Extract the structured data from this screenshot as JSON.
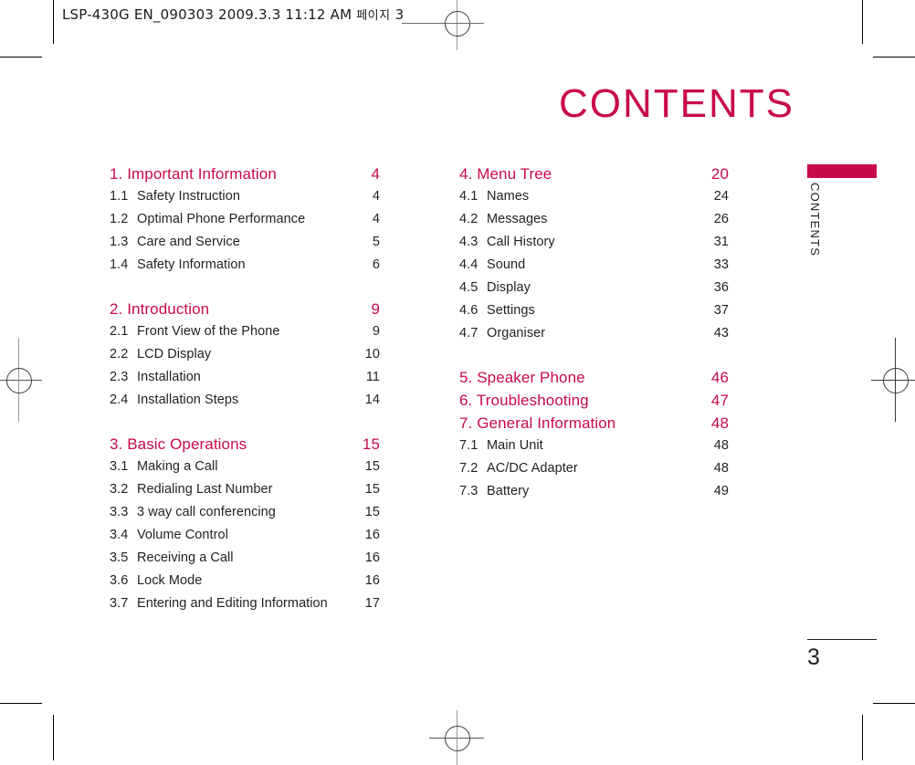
{
  "header": {
    "slug_main": "LSP-430G EN_090303  2009.3.3 11:12 AM",
    "slug_korean": "페이지",
    "slug_page": "3"
  },
  "page_title": "CONTENTS",
  "side_tab": {
    "label": "CONTENTS",
    "color": "#c80a4b"
  },
  "folio": {
    "number": "3"
  },
  "toc": {
    "left_column": [
      {
        "type": "chapter",
        "label": "1. Important Information",
        "page": "4",
        "children": [
          {
            "num": "1.1",
            "label": "Safety Instruction",
            "page": "4"
          },
          {
            "num": "1.2",
            "label": "Optimal Phone Performance",
            "page": "4"
          },
          {
            "num": "1.3",
            "label": "Care and Service",
            "page": "5"
          },
          {
            "num": "1.4",
            "label": "Safety Information",
            "page": "6"
          }
        ]
      },
      {
        "type": "chapter",
        "label": "2. Introduction",
        "page": "9",
        "children": [
          {
            "num": "2.1",
            "label": "Front View of the Phone",
            "page": "9"
          },
          {
            "num": "2.2",
            "label": "LCD Display",
            "page": "10"
          },
          {
            "num": "2.3",
            "label": "Installation",
            "page": "11"
          },
          {
            "num": "2.4",
            "label": "Installation Steps",
            "page": "14"
          }
        ]
      },
      {
        "type": "chapter",
        "label": "3. Basic Operations",
        "page": "15",
        "children": [
          {
            "num": "3.1",
            "label": "Making a Call",
            "page": "15"
          },
          {
            "num": "3.2",
            "label": "Redialing Last Number",
            "page": "15"
          },
          {
            "num": "3.3",
            "label": "3 way call conferencing",
            "page": "15"
          },
          {
            "num": "3.4",
            "label": "Volume Control",
            "page": "16"
          },
          {
            "num": "3.5",
            "label": "Receiving a Call",
            "page": "16"
          },
          {
            "num": "3.6",
            "label": "Lock Mode",
            "page": "16"
          },
          {
            "num": "3.7",
            "label": "Entering and Editing Information",
            "page": "17"
          }
        ]
      }
    ],
    "right_column": [
      {
        "type": "chapter",
        "label": "4. Menu Tree",
        "page": "20",
        "children": [
          {
            "num": "4.1",
            "label": "Names",
            "page": "24"
          },
          {
            "num": "4.2",
            "label": "Messages",
            "page": "26"
          },
          {
            "num": "4.3",
            "label": "Call History",
            "page": "31"
          },
          {
            "num": "4.4",
            "label": "Sound",
            "page": "33"
          },
          {
            "num": "4.5",
            "label": "Display",
            "page": "36"
          },
          {
            "num": "4.6",
            "label": "Settings",
            "page": "37"
          },
          {
            "num": "4.7",
            "label": "Organiser",
            "page": "43"
          }
        ]
      },
      {
        "type": "chapter",
        "label": "5. Speaker Phone",
        "page": "46",
        "children": []
      },
      {
        "type": "chapter",
        "label": "6. Troubleshooting",
        "page": "47",
        "children": []
      },
      {
        "type": "chapter",
        "label": "7. General Information",
        "page": "48",
        "children": [
          {
            "num": "7.1",
            "label": "Main Unit",
            "page": "48"
          },
          {
            "num": "7.2",
            "label": "AC/DC Adapter",
            "page": "48"
          },
          {
            "num": "7.3",
            "label": "Battery",
            "page": "49"
          }
        ]
      }
    ]
  }
}
